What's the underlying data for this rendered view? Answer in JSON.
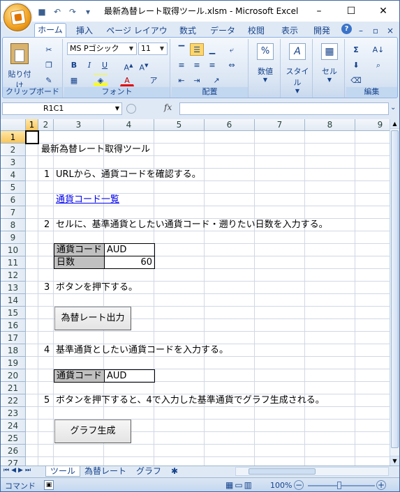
{
  "window": {
    "title": "最新為替レート取得ツール.xlsm - Microsoft Excel",
    "minimize": "–",
    "maximize": "☐",
    "close": "✕"
  },
  "ribbon_tabs": [
    "ホーム",
    "挿入",
    "ページ レイアウト",
    "数式",
    "データ",
    "校閲",
    "表示",
    "開発"
  ],
  "help_label": "?",
  "groups": {
    "clipboard": {
      "label": "クリップボード",
      "paste": "貼り付け"
    },
    "font": {
      "label": "フォント",
      "font_name": "MS Pゴシック",
      "font_size": "11"
    },
    "alignment": {
      "label": "配置"
    },
    "number": {
      "label": "数値"
    },
    "style": {
      "label": "スタイル"
    },
    "cells": {
      "label": "セル"
    },
    "edit": {
      "label": "編集"
    }
  },
  "formula_bar": {
    "name_box": "R1C1",
    "fx": "fx",
    "value": ""
  },
  "columns": [
    "1",
    "2",
    "3",
    "4",
    "5",
    "6",
    "7",
    "8",
    "9"
  ],
  "rows": [
    "1",
    "2",
    "3",
    "4",
    "5",
    "6",
    "7",
    "8",
    "9",
    "10",
    "11",
    "12",
    "13",
    "14",
    "15",
    "16",
    "17",
    "18",
    "19",
    "20",
    "21",
    "22",
    "23",
    "24",
    "25",
    "26",
    "27"
  ],
  "sheet": {
    "title": "最新為替レート取得ツール",
    "step1_no": "1",
    "step1": "URLから、通貨コードを確認する。",
    "link": "通貨コード一覧",
    "step2_no": "2",
    "step2": "セルに、基準通貨としたい通貨コード・遡りたい日数を入力する。",
    "input_currency_label": "通貨コード",
    "input_currency_value": "AUD",
    "input_days_label": "日数",
    "input_days_value": "60",
    "step3_no": "3",
    "step3": "ボタンを押下する。",
    "button_rate": "為替レート出力",
    "step4_no": "4",
    "step4": "基準通貨としたい通貨コードを入力する。",
    "base_currency_label": "通貨コード",
    "base_currency_value": "AUD",
    "step5_no": "5",
    "step5": "ボタンを押下すると、4で入力した基準通貨でグラフ生成される。",
    "button_graph": "グラフ生成"
  },
  "sheet_tabs": [
    "ツール",
    "為替レート",
    "グラフ"
  ],
  "status": {
    "mode": "コマンド",
    "zoom": "100%"
  }
}
